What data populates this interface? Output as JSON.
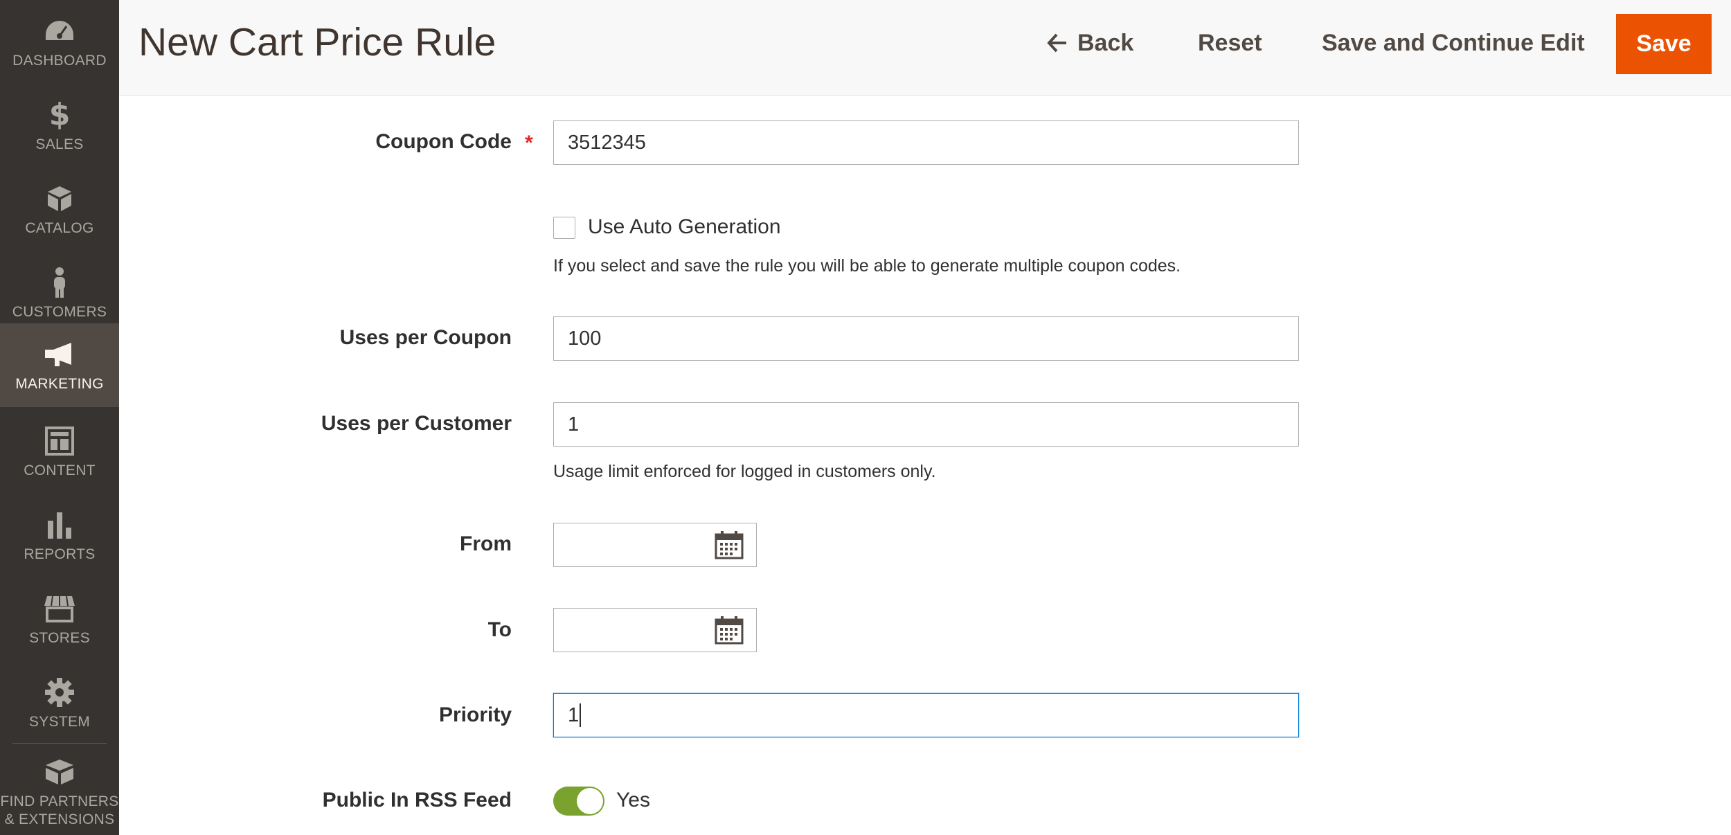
{
  "sidebar": {
    "items": [
      {
        "label": "DASHBOARD",
        "icon": "dashboard-gauge-icon"
      },
      {
        "label": "SALES",
        "icon": "dollar-icon"
      },
      {
        "label": "CATALOG",
        "icon": "box-icon"
      },
      {
        "label": "CUSTOMERS",
        "icon": "person-icon"
      },
      {
        "label": "MARKETING",
        "icon": "megaphone-icon",
        "active": true
      },
      {
        "label": "CONTENT",
        "icon": "layout-icon"
      },
      {
        "label": "REPORTS",
        "icon": "bar-chart-icon"
      },
      {
        "label": "STORES",
        "icon": "storefront-icon"
      },
      {
        "label": "SYSTEM",
        "icon": "gear-icon"
      },
      {
        "label": "FIND PARTNERS & EXTENSIONS",
        "icon": "blocks-icon"
      }
    ]
  },
  "header": {
    "title": "New Cart Price Rule",
    "back_label": "Back",
    "reset_label": "Reset",
    "save_continue_label": "Save and Continue Edit",
    "save_label": "Save"
  },
  "form": {
    "coupon_code": {
      "label": "Coupon Code",
      "required": "*",
      "value": "3512345"
    },
    "auto_generation": {
      "label": "Use Auto Generation",
      "checked": false,
      "note": "If you select and save the rule you will be able to generate multiple coupon codes."
    },
    "uses_per_coupon": {
      "label": "Uses per Coupon",
      "value": "100"
    },
    "uses_per_customer": {
      "label": "Uses per Customer",
      "value": "1",
      "note": "Usage limit enforced for logged in customers only."
    },
    "from": {
      "label": "From",
      "value": ""
    },
    "to": {
      "label": "To",
      "value": ""
    },
    "priority": {
      "label": "Priority",
      "value": "1"
    },
    "public_rss": {
      "label": "Public In RSS Feed",
      "value": "Yes",
      "enabled": true
    }
  },
  "colors": {
    "sidebar_bg": "#373330",
    "sidebar_active": "#514943",
    "save_button": "#eb5202",
    "toggle_on": "#79a22e",
    "focus_border": "#007bdb"
  }
}
